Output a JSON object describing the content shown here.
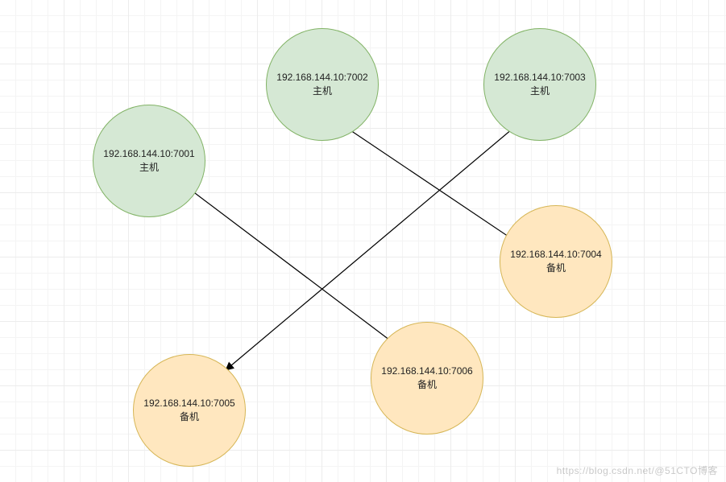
{
  "nodes": {
    "n7001": {
      "ip": "192.168.144.10:7001",
      "role": "主机"
    },
    "n7002": {
      "ip": "192.168.144.10:7002",
      "role": "主机"
    },
    "n7003": {
      "ip": "192.168.144.10:7003",
      "role": "主机"
    },
    "n7004": {
      "ip": "192.168.144.10:7004",
      "role": "备机"
    },
    "n7005": {
      "ip": "192.168.144.10:7005",
      "role": "备机"
    },
    "n7006": {
      "ip": "192.168.144.10:7006",
      "role": "备机"
    }
  },
  "colors": {
    "master_fill": "#d5e8d4",
    "master_stroke": "#82b366",
    "backup_fill": "#ffe7bf",
    "backup_stroke": "#d6b656"
  },
  "edges": [
    {
      "from": "n7003",
      "to": "n7005",
      "bidirectional": true
    },
    {
      "from": "n7002",
      "to": "n7004",
      "bidirectional": true
    },
    {
      "from": "n7001",
      "to": "n7006",
      "bidirectional": true
    }
  ],
  "watermark": "https://blog.csdn.net/@51CTO博客"
}
